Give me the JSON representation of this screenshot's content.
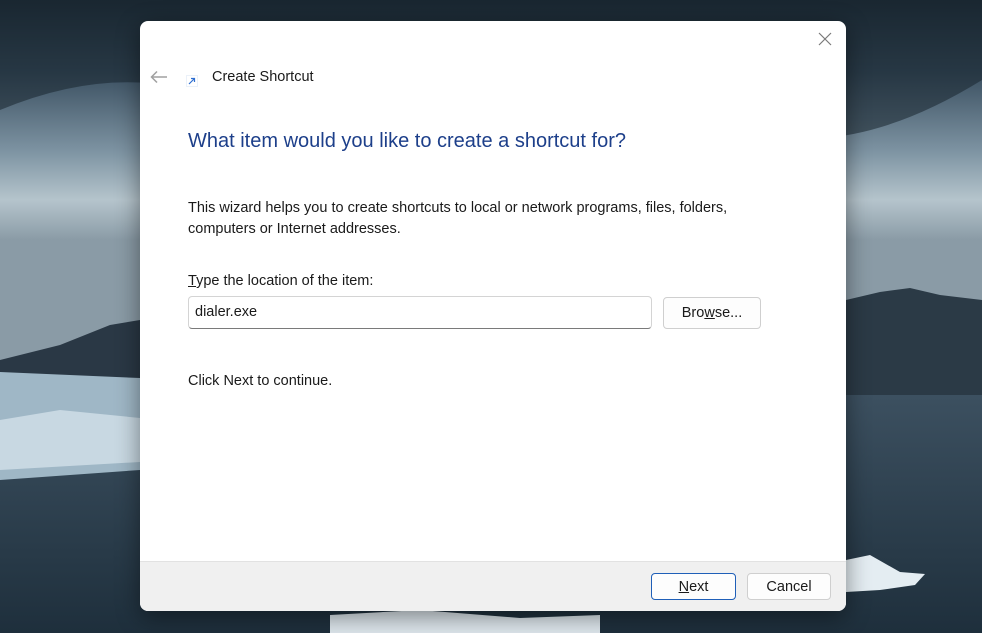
{
  "dialog": {
    "title": "Create Shortcut",
    "heading": "What item would you like to create a shortcut for?",
    "description": "This wizard helps you to create shortcuts to local or network programs, files, folders, computers or Internet addresses.",
    "location_label_mnemonic": "T",
    "location_label_rest": "ype the location of the item:",
    "location_value": "dialer.exe",
    "browse_mnemonic": "w",
    "browse_pre": "Bro",
    "browse_post": "se...",
    "continue_text": "Click Next to continue.",
    "next_mnemonic": "N",
    "next_rest": "ext",
    "cancel_label": "Cancel"
  },
  "icons": {
    "close": "close-icon",
    "back": "back-arrow-icon",
    "shortcut": "shortcut-arrow-icon"
  },
  "colors": {
    "heading": "#1d3f8a",
    "primary_border": "#1f5fb8",
    "footer": "#f0f0f0"
  }
}
